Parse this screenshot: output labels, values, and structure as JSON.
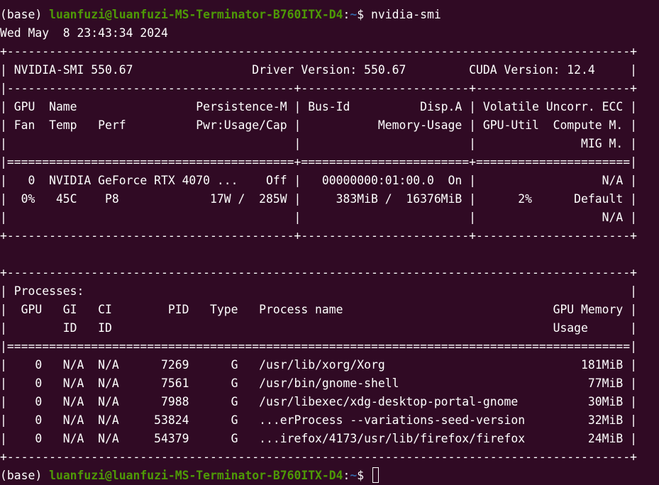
{
  "terminal": {
    "prompt_env": "(base) ",
    "prompt_user": "luanfuzi@luanfuzi-MS-Terminator-B760ITX-D4",
    "prompt_sep": ":",
    "prompt_path": "~",
    "prompt_symbol": "$ ",
    "command": "nvidia-smi",
    "output_lines": [
      "Wed May  8 23:43:34 2024",
      "+-----------------------------------------------------------------------------------------+",
      "| NVIDIA-SMI 550.67                 Driver Version: 550.67         CUDA Version: 12.4     |",
      "|-----------------------------------------+------------------------+----------------------+",
      "| GPU  Name                 Persistence-M | Bus-Id          Disp.A | Volatile Uncorr. ECC |",
      "| Fan  Temp   Perf          Pwr:Usage/Cap |           Memory-Usage | GPU-Util  Compute M. |",
      "|                                         |                        |               MIG M. |",
      "|=========================================+========================+======================|",
      "|   0  NVIDIA GeForce RTX 4070 ...    Off |   00000000:01:00.0  On |                  N/A |",
      "|  0%   45C    P8             17W /  285W |     383MiB /  16376MiB |      2%      Default |",
      "|                                         |                        |                  N/A |",
      "+-----------------------------------------+------------------------+----------------------+",
      "",
      "+-----------------------------------------------------------------------------------------+",
      "| Processes:                                                                              |",
      "|  GPU   GI   CI        PID   Type   Process name                              GPU Memory |",
      "|        ID   ID                                                               Usage      |",
      "|=========================================================================================|",
      "|    0   N/A  N/A      7269      G   /usr/lib/xorg/Xorg                            181MiB |",
      "|    0   N/A  N/A      7561      G   /usr/bin/gnome-shell                           77MiB |",
      "|    0   N/A  N/A      7988      G   /usr/libexec/xdg-desktop-portal-gnome          30MiB |",
      "|    0   N/A  N/A     53824      G   ...erProcess --variations-seed-version         32MiB |",
      "|    0   N/A  N/A     54379      G   ...irefox/4173/usr/lib/firefox/firefox         24MiB |",
      "+-----------------------------------------------------------------------------------------+"
    ]
  },
  "colors": {
    "background": "#300a24",
    "text": "#ffffff",
    "user": "#4e9a06",
    "path": "#3465a4"
  }
}
